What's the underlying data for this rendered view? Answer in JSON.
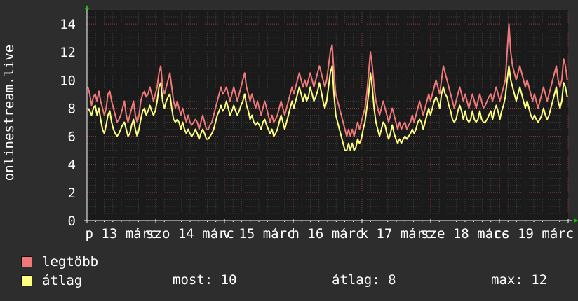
{
  "chart_data": {
    "type": "line",
    "ylabel": "onlinestream.live",
    "ylim": [
      0,
      15
    ],
    "yticks": [
      0,
      2,
      4,
      6,
      8,
      10,
      12,
      14
    ],
    "x_tick_labels": [
      "p 13 márc",
      "szo 14 márc",
      "v 15 márc",
      "h 16 márc",
      "k 17 márc",
      "sze 18 márc",
      "cs 19 márc"
    ],
    "grid": true,
    "legend_position": "bottom-left",
    "series": [
      {
        "name": "legtöbb",
        "color": "#f07878",
        "values": [
          9.5,
          9.0,
          8.2,
          8.8,
          9.0,
          8.5,
          9.2,
          8.5,
          8.0,
          7.5,
          8.0,
          9.0,
          9.2,
          8.5,
          8.0,
          7.5,
          7.0,
          7.2,
          7.5,
          8.0,
          8.5,
          7.5,
          7.0,
          7.5,
          8.0,
          8.5,
          7.5,
          7.0,
          7.5,
          8.5,
          9.0,
          9.2,
          8.8,
          9.0,
          9.5,
          9.0,
          8.5,
          9.0,
          9.5,
          10.5,
          11.0,
          9.5,
          9.0,
          9.5,
          10.0,
          10.5,
          9.5,
          8.5,
          8.0,
          8.5,
          8.0,
          7.5,
          8.0,
          7.5,
          7.0,
          7.5,
          7.0,
          6.8,
          7.0,
          7.2,
          7.0,
          6.5,
          7.0,
          7.5,
          7.0,
          6.5,
          6.5,
          6.8,
          7.0,
          7.5,
          8.0,
          8.5,
          9.0,
          9.5,
          9.0,
          9.2,
          9.5,
          9.0,
          8.5,
          9.0,
          9.5,
          9.0,
          8.5,
          9.0,
          9.5,
          10.0,
          10.5,
          9.5,
          9.0,
          8.5,
          9.0,
          8.5,
          8.0,
          8.5,
          8.0,
          7.5,
          8.0,
          8.5,
          8.0,
          7.5,
          7.0,
          7.5,
          7.0,
          7.2,
          7.5,
          8.0,
          8.5,
          8.0,
          7.5,
          8.0,
          8.5,
          9.0,
          9.5,
          9.0,
          9.5,
          10.0,
          10.5,
          10.0,
          9.5,
          10.0,
          9.5,
          10.0,
          10.5,
          10.0,
          9.5,
          10.0,
          10.5,
          11.0,
          10.5,
          10.0,
          9.5,
          10.0,
          11.0,
          12.0,
          12.5,
          10.5,
          9.0,
          8.5,
          8.0,
          7.5,
          7.0,
          6.5,
          6.0,
          6.5,
          6.0,
          6.5,
          6.0,
          6.5,
          7.0,
          6.5,
          7.0,
          7.5,
          8.0,
          9.0,
          10.5,
          12.0,
          11.0,
          9.5,
          8.5,
          8.0,
          7.5,
          8.0,
          8.5,
          8.0,
          7.5,
          7.0,
          7.5,
          8.0,
          7.5,
          7.0,
          6.5,
          7.0,
          6.5,
          6.8,
          7.0,
          6.5,
          6.8,
          7.0,
          7.5,
          7.0,
          7.5,
          8.0,
          8.5,
          8.0,
          7.5,
          8.0,
          8.5,
          9.0,
          8.5,
          9.0,
          9.5,
          10.0,
          9.5,
          9.0,
          10.0,
          11.0,
          10.5,
          10.0,
          9.5,
          9.0,
          8.5,
          8.0,
          8.5,
          9.0,
          9.5,
          9.0,
          8.5,
          9.0,
          8.5,
          8.0,
          8.5,
          9.0,
          8.5,
          8.0,
          8.5,
          9.0,
          8.5,
          8.0,
          8.2,
          8.5,
          8.8,
          9.0,
          8.5,
          9.0,
          9.5,
          9.0,
          8.5,
          9.0,
          9.5,
          10.0,
          12.0,
          14.0,
          12.0,
          11.0,
          10.5,
          10.0,
          10.5,
          11.0,
          10.5,
          10.0,
          9.5,
          10.0,
          9.5,
          9.0,
          8.5,
          9.0,
          8.5,
          8.0,
          8.5,
          9.0,
          9.5,
          9.0,
          8.5,
          9.0,
          9.5,
          10.0,
          10.5,
          11.0,
          10.0,
          9.5,
          10.0,
          11.5,
          11.0,
          10.0
        ]
      },
      {
        "name": "átlag",
        "color": "#ffff80",
        "values": [
          8.0,
          7.8,
          7.5,
          8.0,
          8.2,
          7.5,
          8.0,
          7.2,
          6.5,
          6.2,
          6.8,
          7.5,
          7.8,
          7.0,
          6.5,
          6.2,
          6.0,
          6.2,
          6.5,
          6.8,
          7.0,
          6.5,
          6.0,
          6.2,
          6.8,
          7.2,
          6.5,
          6.0,
          6.5,
          7.2,
          7.8,
          8.0,
          7.5,
          7.8,
          8.2,
          7.8,
          7.5,
          7.8,
          8.5,
          9.5,
          9.8,
          8.5,
          8.0,
          8.5,
          8.8,
          9.0,
          8.0,
          7.2,
          7.0,
          7.2,
          7.0,
          6.5,
          7.0,
          6.5,
          6.2,
          6.5,
          6.2,
          6.0,
          6.2,
          6.5,
          6.2,
          5.8,
          6.2,
          6.5,
          6.2,
          5.8,
          5.8,
          6.0,
          6.2,
          6.5,
          7.0,
          7.5,
          7.8,
          8.2,
          7.8,
          8.0,
          8.5,
          8.0,
          7.5,
          7.8,
          8.2,
          7.8,
          7.5,
          7.8,
          8.2,
          8.5,
          9.0,
          8.2,
          7.8,
          7.2,
          7.5,
          7.0,
          6.8,
          7.0,
          6.8,
          6.5,
          7.0,
          7.2,
          6.8,
          6.5,
          6.2,
          6.5,
          6.0,
          6.2,
          6.5,
          7.0,
          7.5,
          7.0,
          6.5,
          7.0,
          7.5,
          8.0,
          8.5,
          8.0,
          8.5,
          9.0,
          9.5,
          9.0,
          8.5,
          9.0,
          8.5,
          8.8,
          9.5,
          9.0,
          8.5,
          8.8,
          9.2,
          9.8,
          9.2,
          8.5,
          8.0,
          8.5,
          9.5,
          10.5,
          11.0,
          9.0,
          7.5,
          7.0,
          6.5,
          6.0,
          5.5,
          5.0,
          5.0,
          5.5,
          5.0,
          5.5,
          5.0,
          5.2,
          5.8,
          5.5,
          5.8,
          6.5,
          7.0,
          8.0,
          9.0,
          10.5,
          9.5,
          8.0,
          7.0,
          6.5,
          6.0,
          6.5,
          7.0,
          6.8,
          6.2,
          5.8,
          6.2,
          6.8,
          6.2,
          5.8,
          5.5,
          5.8,
          5.5,
          5.8,
          6.0,
          5.8,
          6.0,
          6.2,
          6.5,
          6.2,
          6.5,
          7.0,
          7.2,
          7.0,
          6.5,
          7.0,
          7.5,
          8.0,
          7.5,
          8.0,
          8.5,
          8.8,
          8.5,
          8.0,
          9.0,
          9.5,
          9.0,
          8.8,
          8.2,
          7.8,
          7.2,
          7.0,
          7.2,
          7.8,
          8.2,
          7.8,
          7.2,
          7.8,
          7.2,
          7.0,
          7.2,
          7.8,
          7.2,
          7.0,
          7.2,
          7.8,
          7.2,
          7.0,
          7.0,
          7.2,
          7.5,
          7.8,
          7.2,
          7.8,
          8.2,
          7.8,
          7.2,
          7.8,
          8.2,
          8.8,
          10.0,
          11.0,
          10.0,
          9.5,
          9.0,
          8.5,
          9.0,
          9.5,
          9.0,
          8.5,
          8.0,
          8.5,
          8.0,
          7.5,
          7.2,
          7.5,
          7.2,
          7.0,
          7.2,
          7.5,
          8.0,
          7.5,
          7.2,
          7.5,
          8.0,
          8.5,
          9.0,
          9.5,
          8.5,
          8.0,
          8.5,
          9.8,
          9.5,
          8.8
        ]
      }
    ]
  },
  "legend": [
    {
      "label": "legtöbb",
      "color": "#f07878"
    },
    {
      "label": "átlag",
      "color": "#ffff80"
    }
  ],
  "stats": {
    "now": "most: 10",
    "avg": "átlag: 8",
    "max": "max: 12"
  }
}
